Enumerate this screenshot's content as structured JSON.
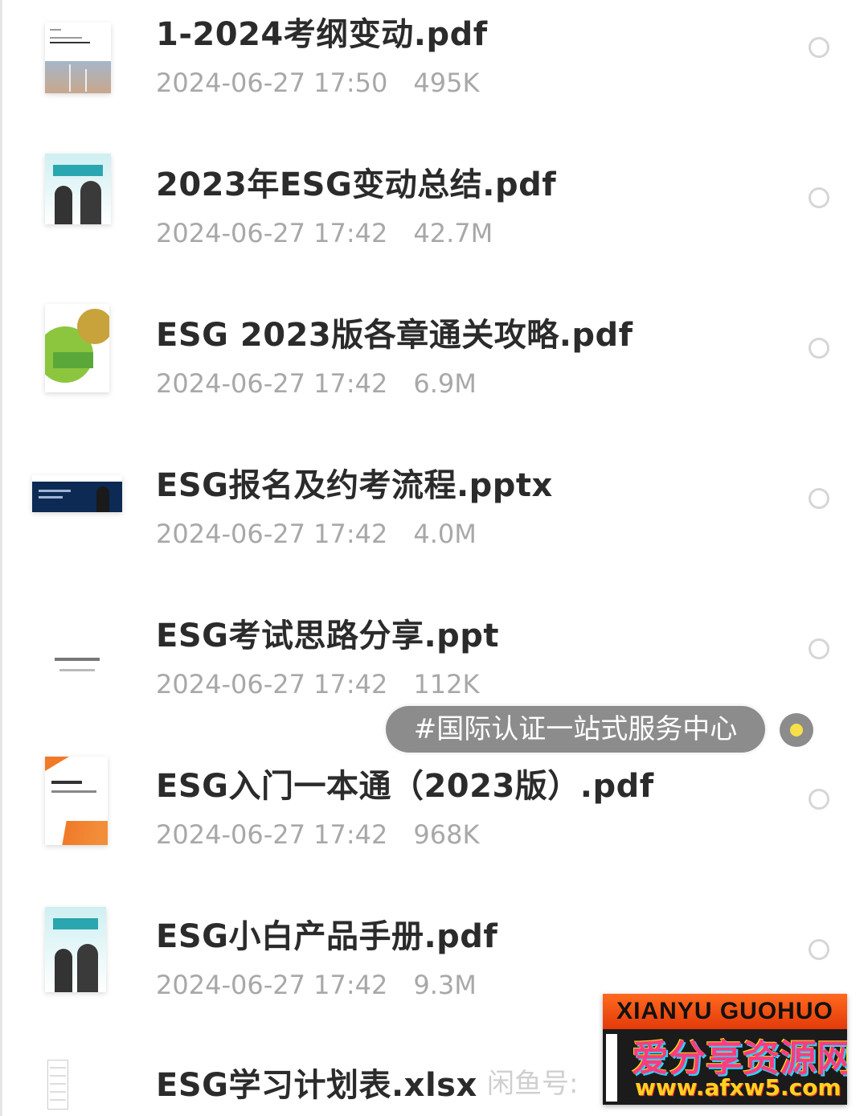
{
  "files": [
    {
      "name": "1-2024考纲变动.pdf",
      "date": "2024-06-27 17:50",
      "size": "495K",
      "thumb": "wind"
    },
    {
      "name": "2023年ESG变动总结.pdf",
      "date": "2024-06-27 17:42",
      "size": "42.7M",
      "thumb": "esg-people"
    },
    {
      "name": "ESG 2023版各章通关攻略.pdf",
      "date": "2024-06-27 17:42",
      "size": "6.9M",
      "thumb": "green"
    },
    {
      "name": "ESG报名及约考流程.pptx",
      "date": "2024-06-27 17:42",
      "size": "4.0M",
      "thumb": "ppt"
    },
    {
      "name": "ESG考试思路分享.ppt",
      "date": "2024-06-27 17:42",
      "size": "112K",
      "thumb": "plain"
    },
    {
      "name": "ESG入门一本通（2023版）.pdf",
      "date": "2024-06-27 17:42",
      "size": "968K",
      "thumb": "orange"
    },
    {
      "name": "ESG小白产品手册.pdf",
      "date": "2024-06-27 17:42",
      "size": "9.3M",
      "thumb": "esg-people"
    },
    {
      "name": "ESG学习计划表.xlsx",
      "date": "",
      "size": "",
      "thumb": "sheet"
    }
  ],
  "tag": "#国际认证一站式服务中心",
  "watermark": {
    "faded_text": "闲鱼号:",
    "banner": "XIANYU GUOHUO",
    "site_name": "爱分享资源网",
    "site_url": "www.afxw5.com"
  },
  "colors": {
    "tag_bg": "#8c8c8c",
    "tag_dot": "#f7e049",
    "radio_border": "#d6d6d6",
    "meta_text": "#a8a8a8"
  }
}
